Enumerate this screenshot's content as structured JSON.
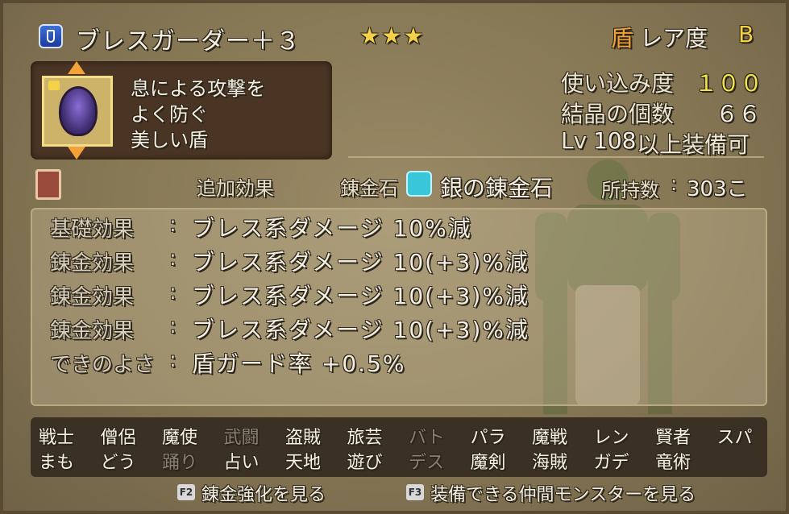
{
  "header": {
    "item_name": "ブレスガーダー＋３",
    "stars": "★★★",
    "type_icon": "盾",
    "rarity_label": "レア度",
    "rarity_value": "B"
  },
  "description": [
    "息による攻撃を",
    "よく防ぐ",
    "美しい盾"
  ],
  "stats": {
    "usage_label": "使い込み度",
    "usage_value": "１００",
    "crystal_label": "結晶の個数",
    "crystal_value": "６６",
    "level_prefix": "Lv",
    "level_value": "108",
    "level_suffix": "以上装備可"
  },
  "middle": {
    "extra_effect": "追加効果",
    "alchemy_label": "錬金石",
    "alchemy_stone": "銀の錬金石",
    "owned_label": "所持数",
    "owned_colon": ":",
    "owned_value": "303こ"
  },
  "effects": [
    {
      "label": "基礎効果",
      "colon": ":",
      "text": "ブレス系ダメージ 10%減"
    },
    {
      "label": "錬金効果",
      "colon": ":",
      "text": "ブレス系ダメージ 10(+3)%減"
    },
    {
      "label": "錬金効果",
      "colon": ":",
      "text": "ブレス系ダメージ 10(+3)%減"
    },
    {
      "label": "錬金効果",
      "colon": ":",
      "text": "ブレス系ダメージ 10(+3)%減"
    },
    {
      "label": "できのよさ",
      "colon": ":",
      "text": "盾ガード率 +0.5%"
    }
  ],
  "jobs_row1": [
    {
      "name": "戦士",
      "enabled": true
    },
    {
      "name": "僧侶",
      "enabled": true
    },
    {
      "name": "魔使",
      "enabled": true
    },
    {
      "name": "武闘",
      "enabled": false
    },
    {
      "name": "盗賊",
      "enabled": true
    },
    {
      "name": "旅芸",
      "enabled": true
    },
    {
      "name": "バト",
      "enabled": false
    },
    {
      "name": "パラ",
      "enabled": true
    },
    {
      "name": "魔戦",
      "enabled": true
    },
    {
      "name": "レン",
      "enabled": true
    },
    {
      "name": "賢者",
      "enabled": true
    },
    {
      "name": "スパ",
      "enabled": true
    }
  ],
  "jobs_row2": [
    {
      "name": "まも",
      "enabled": true
    },
    {
      "name": "どう",
      "enabled": true
    },
    {
      "name": "踊り",
      "enabled": false
    },
    {
      "name": "占い",
      "enabled": true
    },
    {
      "name": "天地",
      "enabled": true
    },
    {
      "name": "遊び",
      "enabled": true
    },
    {
      "name": "デス",
      "enabled": false
    },
    {
      "name": "魔剣",
      "enabled": true
    },
    {
      "name": "海賊",
      "enabled": true
    },
    {
      "name": "ガデ",
      "enabled": true
    },
    {
      "name": "竜術",
      "enabled": true
    }
  ],
  "footer": {
    "f2_key": "F2",
    "f2_label": "錬金強化を見る",
    "f3_key": "F3",
    "f3_label": "装備できる仲間モンスターを見る"
  }
}
